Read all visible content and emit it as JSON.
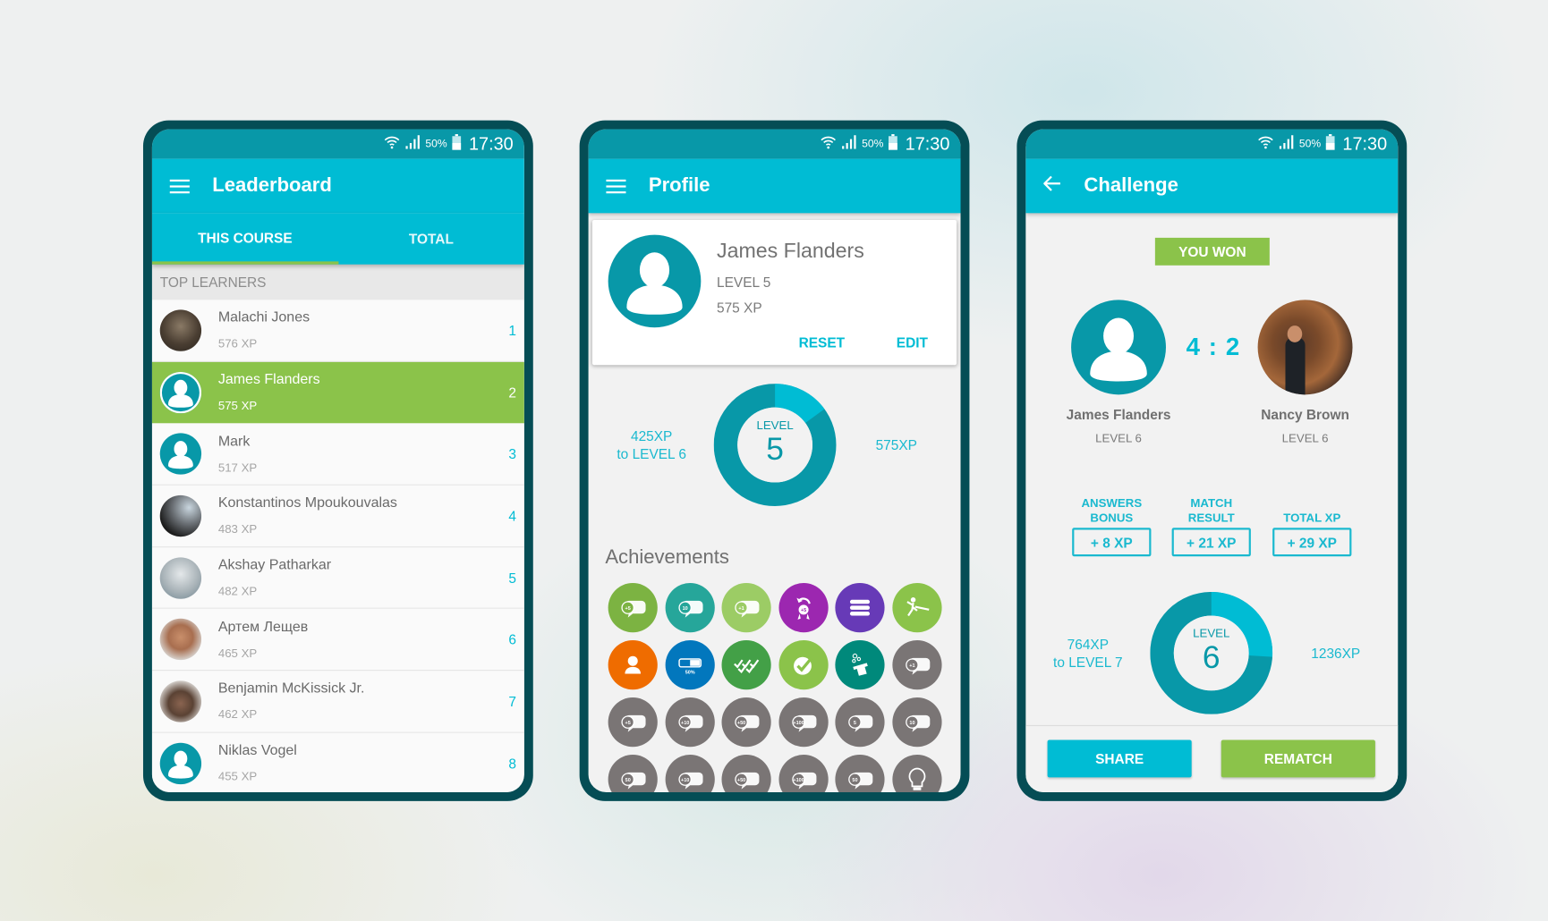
{
  "status_bar": {
    "battery": "50%",
    "time": "17:30"
  },
  "colors": {
    "primary": "#00bcd4",
    "primary_dark": "#0898a8",
    "accent_green": "#8bc34a",
    "frame": "#054d55"
  },
  "leaderboard": {
    "title": "Leaderboard",
    "tabs": [
      {
        "label": "THIS COURSE",
        "active": true
      },
      {
        "label": "TOTAL",
        "active": false
      }
    ],
    "section_header": "TOP LEARNERS",
    "rows": [
      {
        "name": "Malachi Jones",
        "xp": "576 XP",
        "rank": "1",
        "avatar": "photo"
      },
      {
        "name": "James Flanders",
        "xp": "575 XP",
        "rank": "2",
        "avatar": "default",
        "current_user": true
      },
      {
        "name": "Mark",
        "xp": "517 XP",
        "rank": "3",
        "avatar": "default"
      },
      {
        "name": "Konstantinos Mpoukouvalas",
        "xp": "483 XP",
        "rank": "4",
        "avatar": "photo"
      },
      {
        "name": "Akshay Patharkar",
        "xp": "482 XP",
        "rank": "5",
        "avatar": "photo"
      },
      {
        "name": "Артем Лещев",
        "xp": "465 XP",
        "rank": "6",
        "avatar": "photo"
      },
      {
        "name": "Benjamin McKissick Jr.",
        "xp": "462 XP",
        "rank": "7",
        "avatar": "photo"
      },
      {
        "name": "Niklas Vogel",
        "xp": "455 XP",
        "rank": "8",
        "avatar": "default"
      }
    ]
  },
  "profile": {
    "title": "Profile",
    "name": "James Flanders",
    "level": "LEVEL 5",
    "xp": "575 XP",
    "reset_label": "RESET",
    "edit_label": "EDIT",
    "progress": {
      "level_label": "LEVEL",
      "level_value": "5",
      "to_next_xp": "425XP",
      "to_next_label": "to LEVEL 6",
      "current_xp": "575XP",
      "fraction": 0.15
    },
    "achievements_title": "Achievements",
    "achievements": [
      {
        "icon": "bubble-badge-plus5-icon",
        "label": "+5",
        "color": "#7cb342",
        "earned": true
      },
      {
        "icon": "bubble-badge-10-icon",
        "label": "10",
        "color": "#26a69a",
        "earned": true
      },
      {
        "icon": "bubble-badge-plus1-icon",
        "label": "+1",
        "color": "#9ccc65",
        "earned": true
      },
      {
        "icon": "undo-badge-plus5-icon",
        "label": "+5",
        "color": "#9c27b0",
        "earned": true
      },
      {
        "icon": "list-icon",
        "label": "",
        "color": "#673ab7",
        "earned": true
      },
      {
        "icon": "finish-line-runner-icon",
        "label": "",
        "color": "#8bc34a",
        "earned": true
      },
      {
        "icon": "user-icon",
        "label": "",
        "color": "#ef6c00",
        "earned": true
      },
      {
        "icon": "progress-50-icon",
        "label": "50%",
        "color": "#0277bd",
        "earned": true
      },
      {
        "icon": "triple-check-icon",
        "label": "",
        "color": "#43a047",
        "earned": true
      },
      {
        "icon": "check-icon",
        "label": "",
        "color": "#8bc34a",
        "earned": true
      },
      {
        "icon": "magic-hat-icon",
        "label": "",
        "color": "#00897b",
        "earned": true
      },
      {
        "icon": "bubble-badge-plus1-icon",
        "label": "+1",
        "color": "#7a7575",
        "earned": false
      },
      {
        "icon": "bubble-badge-plus5-icon",
        "label": "+5",
        "color": "#7a7575",
        "earned": false
      },
      {
        "icon": "bubble-badge-plus10-icon",
        "label": "+10",
        "color": "#7a7575",
        "earned": false
      },
      {
        "icon": "bubble-badge-plus50-icon",
        "label": "+50",
        "color": "#7a7575",
        "earned": false
      },
      {
        "icon": "bubble-badge-plus100-icon",
        "label": "+100",
        "color": "#7a7575",
        "earned": false
      },
      {
        "icon": "bubble-gear-5-icon",
        "label": "5",
        "color": "#7a7575",
        "earned": false
      },
      {
        "icon": "bubble-gear-10-icon",
        "label": "10",
        "color": "#7a7575",
        "earned": false
      },
      {
        "icon": "bubble-gear-50-icon",
        "label": "50",
        "color": "#7a7575",
        "earned": false
      },
      {
        "icon": "badge-bubble-check-plus10-icon",
        "label": "+10",
        "color": "#7a7575",
        "earned": false
      },
      {
        "icon": "badge-bubble-check-plus50-icon",
        "label": "+50",
        "color": "#7a7575",
        "earned": false
      },
      {
        "icon": "badge-bubble-check-plus100-icon",
        "label": "+100",
        "color": "#7a7575",
        "earned": false
      },
      {
        "icon": "gear-bubble-check-50-icon",
        "label": "50",
        "color": "#7a7575",
        "earned": false
      },
      {
        "icon": "lightbulb-icon",
        "label": "",
        "color": "#7a7575",
        "earned": false
      }
    ]
  },
  "challenge": {
    "title": "Challenge",
    "result_badge": "YOU WON",
    "score": "4 : 2",
    "player1": {
      "name": "James Flanders",
      "level": "LEVEL 6"
    },
    "player2": {
      "name": "Nancy Brown",
      "level": "LEVEL 6"
    },
    "bonuses": [
      {
        "label": "ANSWERS BONUS",
        "value": "+ 8 XP"
      },
      {
        "label": "MATCH RESULT",
        "value": "+ 21 XP"
      },
      {
        "label": "TOTAL XP",
        "value": "+ 29 XP"
      }
    ],
    "progress": {
      "level_label": "LEVEL",
      "level_value": "6",
      "to_next_xp": "764XP",
      "to_next_label": "to LEVEL 7",
      "current_xp": "1236XP",
      "fraction": 0.26
    },
    "share_label": "SHARE",
    "rematch_label": "REMATCH"
  }
}
